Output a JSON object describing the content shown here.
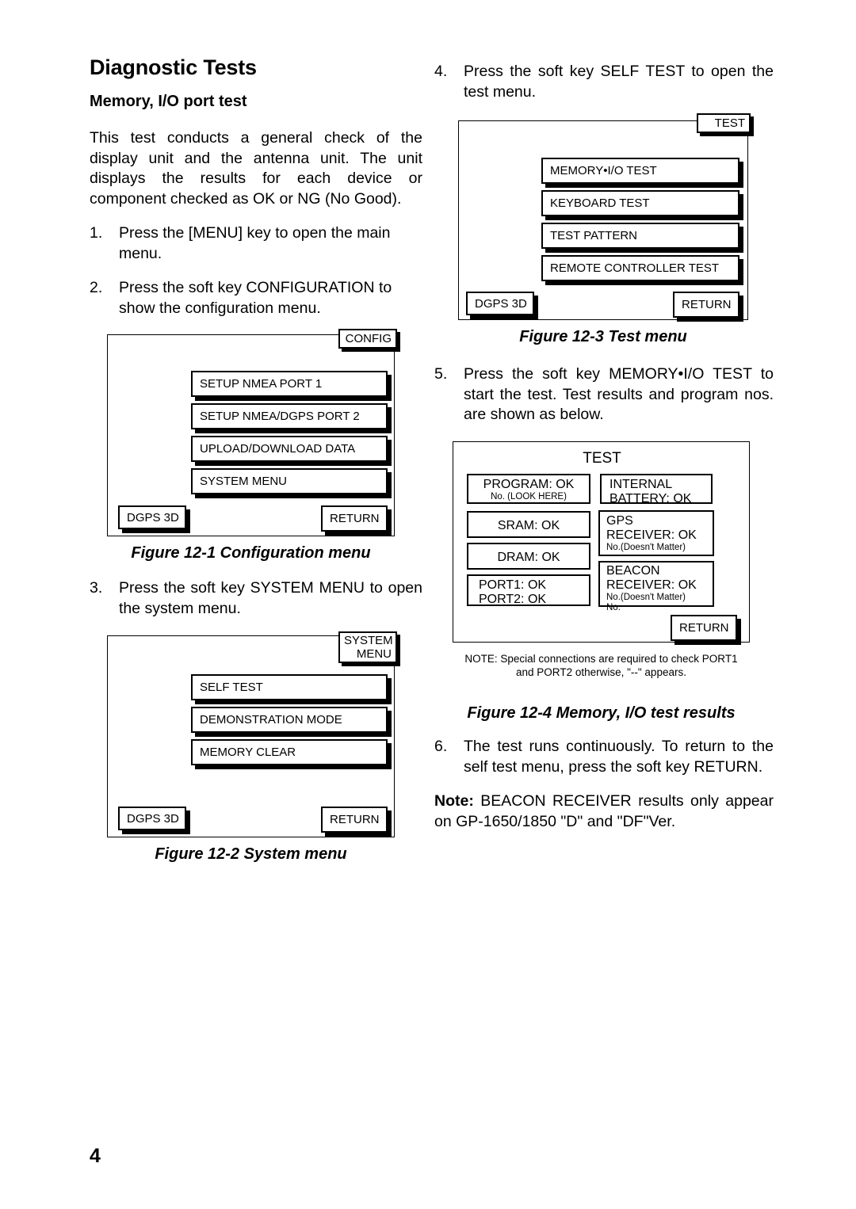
{
  "document": {
    "title": "Diagnostic Tests",
    "subtitle": "Memory, I/O port test",
    "intro": "This test conducts a general check of the display unit and the antenna unit. The unit displays the results for each device or component checked as OK or NG (No Good).",
    "page_number": "4"
  },
  "steps": {
    "s1": {
      "num": "1.",
      "text": "Press the [MENU] key to open the main menu."
    },
    "s2": {
      "num": "2.",
      "text": "Press the soft key CONFIGURATION to show the configuration menu."
    },
    "s3": {
      "num": "3.",
      "text": "Press the soft key SYSTEM MENU to open the system menu."
    },
    "s4": {
      "num": "4.",
      "text": "Press the soft key SELF TEST to open the test menu."
    },
    "s5": {
      "num": "5.",
      "text": "Press the soft key MEMORY•I/O TEST to start the test. Test results and program nos. are shown as below."
    },
    "s6": {
      "num": "6.",
      "text": "The test runs continuously. To return to the self test menu, press the soft key RETURN."
    }
  },
  "note": {
    "label": "Note:",
    "text": " BEACON RECEIVER results only appear on GP-1650/1850 \"D\" and \"DF\"Ver."
  },
  "fig1": {
    "caption": "Figure 12-1 Configuration menu",
    "title": "CONFIG",
    "items": [
      {
        "label": "SETUP NMEA PORT 1"
      },
      {
        "label": "SETUP NMEA/DGPS PORT 2"
      },
      {
        "label": "UPLOAD/DOWNLOAD DATA"
      },
      {
        "label": "SYSTEM MENU"
      }
    ],
    "status": "DGPS 3D",
    "return": "RETURN"
  },
  "fig2": {
    "caption": "Figure 12-2 System menu",
    "title_line1": "SYSTEM",
    "title_line2": "MENU",
    "items": [
      {
        "label": "SELF TEST"
      },
      {
        "label": "DEMONSTRATION MODE"
      },
      {
        "label": "MEMORY CLEAR"
      }
    ],
    "status": "DGPS 3D",
    "return": "RETURN"
  },
  "fig3": {
    "caption": "Figure 12-3 Test menu",
    "title": "TEST",
    "items": [
      {
        "label": "MEMORY•I/O TEST"
      },
      {
        "label": "KEYBOARD TEST"
      },
      {
        "label": "TEST PATTERN"
      },
      {
        "label": "REMOTE CONTROLLER TEST"
      }
    ],
    "status": "DGPS 3D",
    "return": "RETURN"
  },
  "fig4": {
    "caption": "Figure 12-4 Memory, I/O test results",
    "header": "TEST",
    "left_results": [
      {
        "line1": "PROGRAM: OK",
        "line2": "No. (LOOK HERE)",
        "line3": ""
      },
      {
        "line1": "SRAM: OK",
        "line2": "",
        "line3": ""
      },
      {
        "line1": "DRAM: OK",
        "line2": "",
        "line3": ""
      },
      {
        "line1": "PORT1: OK",
        "line2": "PORT2: OK",
        "line3": ""
      }
    ],
    "right_results": [
      {
        "line1": "INTERNAL",
        "line2": "BATTERY: OK",
        "line3": "",
        "line4": ""
      },
      {
        "line1": "GPS",
        "line2": "RECEIVER: OK",
        "line3": "No.(Doesn't Matter)",
        "line4": ""
      },
      {
        "line1": "BEACON",
        "line2": "RECEIVER: OK",
        "line3": "No.(Doesn't Matter)",
        "line4": "No."
      }
    ],
    "return": "RETURN",
    "note_line1": "NOTE: Special connections are required to check PORT1",
    "note_line2": "and PORT2 otherwise, \"--\" appears."
  }
}
